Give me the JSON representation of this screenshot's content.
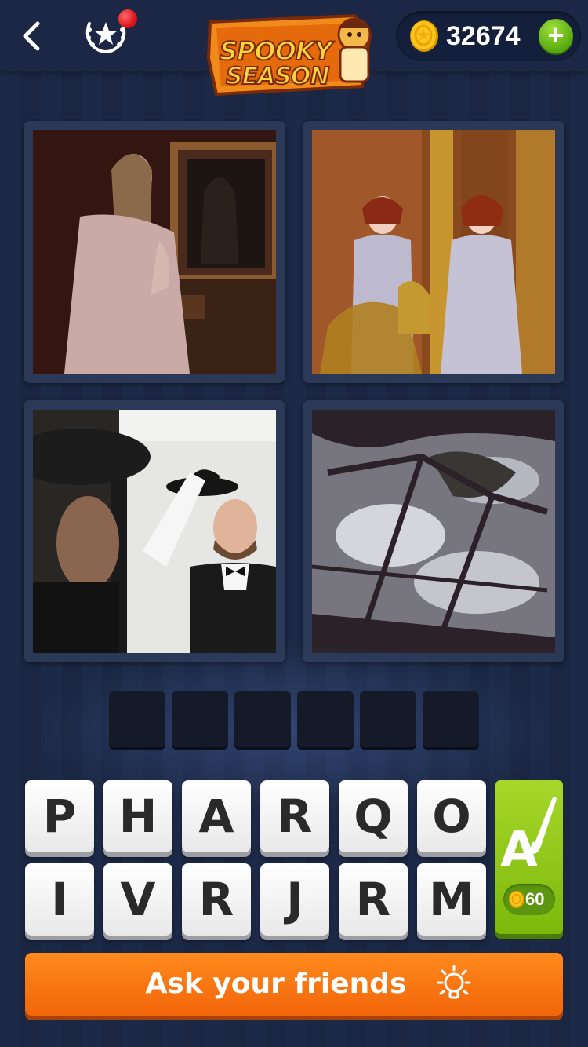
{
  "header": {
    "logo_line1": "SPOOKY",
    "logo_line2": "SEASON",
    "coins": "32674"
  },
  "pictures": [
    {
      "name": "woman-mirror-ghost"
    },
    {
      "name": "twin-women-mirror"
    },
    {
      "name": "man-hat-mirror"
    },
    {
      "name": "cracked-mirror-reflection"
    }
  ],
  "answer_slots": [
    "",
    "",
    "",
    "",
    "",
    ""
  ],
  "letters": [
    "P",
    "H",
    "A",
    "R",
    "Q",
    "O",
    "I",
    "V",
    "R",
    "J",
    "R",
    "M"
  ],
  "hint": {
    "icon_letter": "A",
    "cost": "60"
  },
  "ask_button": {
    "label": "Ask your friends"
  },
  "colors": {
    "background": "#1d2a47",
    "accent_orange": "#f2650a",
    "hint_green": "#7cb80c",
    "coin_gold": "#ffc51a"
  }
}
